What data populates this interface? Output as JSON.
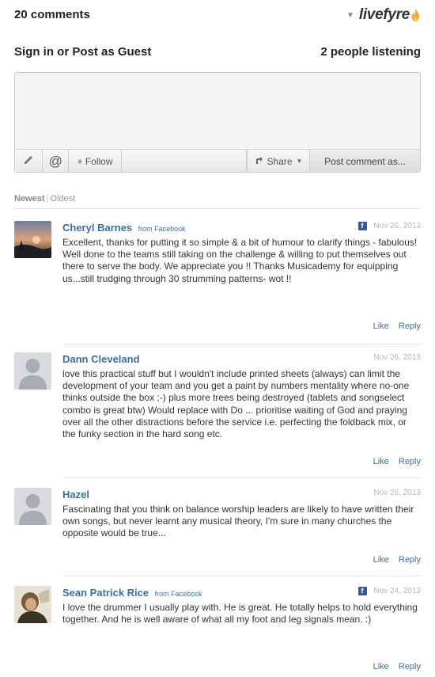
{
  "header": {
    "comment_count": "20 comments",
    "logo_text": "livefyre"
  },
  "signbar": {
    "sign_in": "Sign in or Post as Guest",
    "listening": "2 people listening"
  },
  "composer": {
    "placeholder": "",
    "follow_label": "+ Follow",
    "share_label": "Share",
    "post_label": "Post comment as..."
  },
  "sort": {
    "newest": "Newest",
    "separator": "|",
    "oldest": "Oldest"
  },
  "comments": [
    {
      "name": "Cheryl Barnes",
      "via": "from Facebook",
      "date": "Nov 26, 2013",
      "source_icon": "facebook-icon",
      "text": "Excellent, thanks for putting it so simple & a bit of humour to clarify things - fabulous! Well done to the teams still taking on the challenge & willing to put themselves out there to serve the body. We appreciate you !! Thanks Musicademy for equipping us...still trudging through 30 strumming patterns- wot !!",
      "like": "Like",
      "reply": "Reply"
    },
    {
      "name": "Dann Cleveland",
      "via": "",
      "date": "Nov 26, 2013",
      "source_icon": "",
      "text": "love this practical stuff but I wouldn't include printed sheets (always) can limit the development of your team and you get a paint by numbers mentality where no-one thinks outside the box ;-) plus more trees being destroyed (tablets and songselect combo is great btw) Would replace with Do ... prioritise waiting of God and praying over all the other distractions before the service i.e. perfecting the foldback mix, or the funky section in the hard song etc.",
      "like": "Like",
      "reply": "Reply"
    },
    {
      "name": "Hazel",
      "via": "",
      "date": "Nov 26, 2013",
      "source_icon": "",
      "text": "Fascinating that you think on balance worship leaders are likely to have written their own songs, but never learnt any musical theory, I'm sure in many churches the opposite would be true...",
      "like": "Like",
      "reply": "Reply"
    },
    {
      "name": "Sean Patrick Rice",
      "via": "from Facebook",
      "date": "Nov 24, 2013",
      "source_icon": "facebook-icon",
      "text": "I love the drummer I usually play with. He is great. He totally helps to hold everything together. And he is well aware of what all my foot and leg signals mean. :)",
      "like": "Like",
      "reply": "Reply"
    }
  ]
}
